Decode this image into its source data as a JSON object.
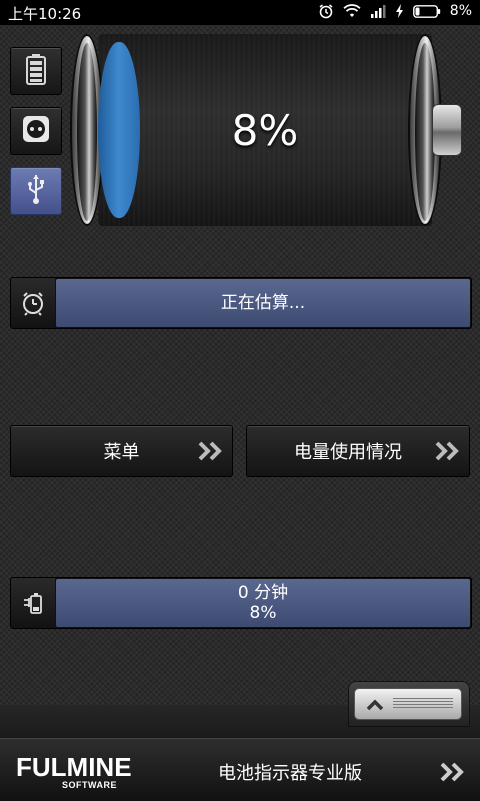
{
  "status_bar": {
    "time": "上午10:26",
    "battery_percent": "8%",
    "icons": [
      "alarm-icon",
      "wifi-icon",
      "signal-icon",
      "charging-icon",
      "battery-icon"
    ]
  },
  "mode_buttons": [
    {
      "icon": "battery-icon",
      "active": false
    },
    {
      "icon": "power-outlet-icon",
      "active": false
    },
    {
      "icon": "usb-icon",
      "active": true
    }
  ],
  "battery": {
    "percent_label": "8%",
    "level": 0.08,
    "fill_color": "#3a82c9"
  },
  "charge_status": {
    "icon": "stopwatch-icon",
    "text": "正在估算..."
  },
  "buttons": {
    "menu_label": "菜单",
    "usage_label": "电量使用情况"
  },
  "remaining": {
    "icon": "battery-plug-icon",
    "line1": "0 分钟",
    "line2": "8%"
  },
  "ad": {
    "logo_text_main": "FULMINE",
    "logo_text_sub": "SOFTWARE",
    "title": "电池指示器专业版"
  },
  "colors": {
    "accent_blue": "#4b5a86",
    "active_button": "#5a68a4"
  }
}
